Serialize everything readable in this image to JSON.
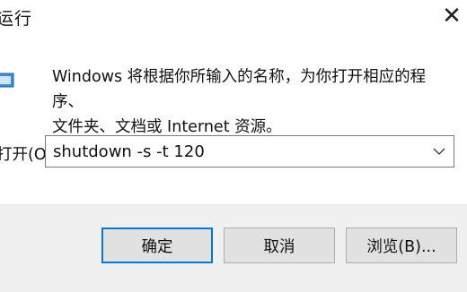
{
  "window": {
    "title": "运行",
    "close_glyph": "✕"
  },
  "icon": {
    "name": "run-app-icon",
    "color": "#3a8fd8"
  },
  "description": {
    "line1": "Windows 将根据你所输入的名称，为你打开相应的程序、",
    "line2": "文件夹、文档或 Internet 资源。"
  },
  "open": {
    "label": "打开(O):",
    "value": "shutdown -s -t 120"
  },
  "buttons": {
    "ok": "确定",
    "cancel": "取消",
    "browse": "浏览(B)..."
  },
  "colors": {
    "accent": "#0078d7",
    "footer_bg": "#f0f0f0",
    "button_bg": "#e1e1e1"
  }
}
